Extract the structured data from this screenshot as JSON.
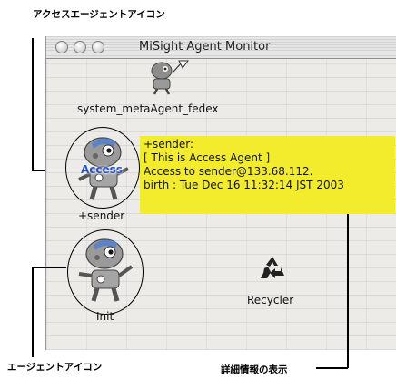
{
  "annotations": {
    "access_agent_icon": "アクセスエージェントアイコン",
    "agent_icon": "エージェントアイコン",
    "detail_display": "詳細情報の表示"
  },
  "window": {
    "title": "MiSight Agent Monitor"
  },
  "agents": {
    "meta_agent_label": "system_metaAgent_fedex",
    "sender_label": "+sender",
    "access_badge": "Access",
    "init_label": "Init",
    "recycler_label": "Recycler"
  },
  "detail": {
    "lines": [
      "+sender:",
      "[ This is Access Agent ]",
      "Access to sender@133.68.112.",
      "birth : Tue Dec 16 11:32:14 JST 2003"
    ]
  },
  "colors": {
    "detail_background": "#f2ec2c",
    "access_text": "#2a52c8"
  },
  "icons": [
    "robot-agent-icon",
    "recycle-icon"
  ]
}
